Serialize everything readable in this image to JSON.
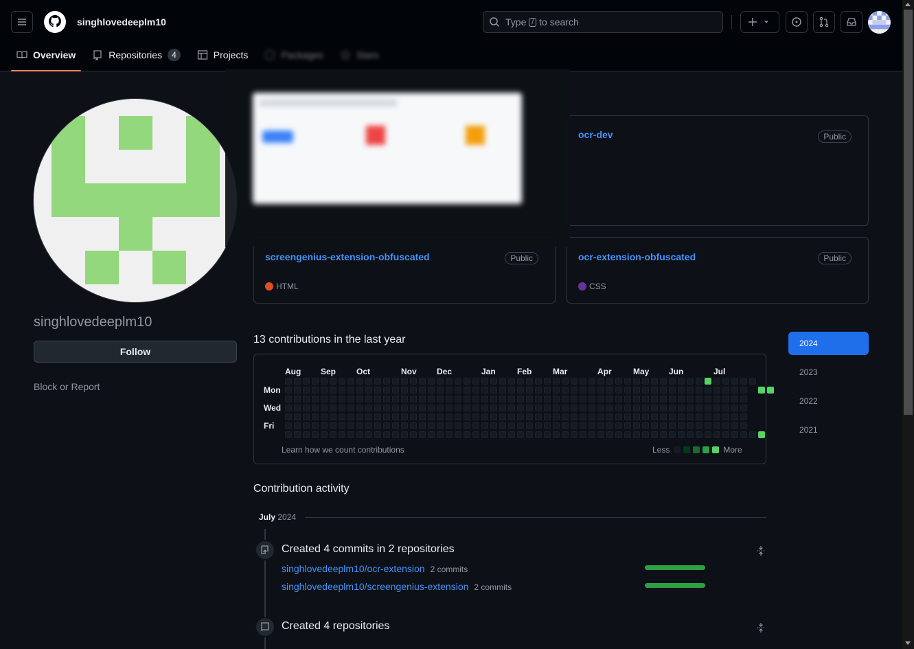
{
  "header": {
    "username": "singhlovedeeplm10",
    "search": {
      "prefix": "Type",
      "key": "/",
      "suffix": "to search"
    }
  },
  "tabs": [
    {
      "label": "Overview",
      "active": true
    },
    {
      "label": "Repositories",
      "count": "4"
    },
    {
      "label": "Projects"
    },
    {
      "label": "Packages"
    },
    {
      "label": "Stars"
    }
  ],
  "profile": {
    "name": "singhlovedeeplm10",
    "follow_label": "Follow",
    "block_label": "Block or Report"
  },
  "pinned": [
    {
      "name": "ocr-dev",
      "visibility": "Public",
      "language": "",
      "lang_color": ""
    },
    {
      "name": "screengenius-extension-obfuscated",
      "visibility": "Public",
      "language": "HTML",
      "lang_color": "#e34c26"
    },
    {
      "name": "ocr-extension-obfuscated",
      "visibility": "Public",
      "language": "CSS",
      "lang_color": "#663399"
    }
  ],
  "contributions": {
    "title": "13 contributions in the last year",
    "months": [
      "Aug",
      "Sep",
      "Oct",
      "Nov",
      "Dec",
      "Jan",
      "Feb",
      "Mar",
      "Apr",
      "May",
      "Jun",
      "Jul"
    ],
    "days": [
      "Mon",
      "Wed",
      "Fri"
    ],
    "learn": "Learn how we count contributions",
    "less": "Less",
    "more": "More",
    "colors": [
      "#151b23",
      "#033a16",
      "#196c2e",
      "#2ea043",
      "#56d364"
    ]
  },
  "years": [
    "2024",
    "2023",
    "2022",
    "2021"
  ],
  "activity": {
    "title": "Contribution activity",
    "month": "July",
    "year": "2024",
    "event1": {
      "title": "Created 4 commits in 2 repositories",
      "repos": [
        {
          "name": "singhlovedeeplm10/ocr-extension",
          "count": "2 commits"
        },
        {
          "name": "singhlovedeeplm10/screengenius-extension",
          "count": "2 commits"
        }
      ]
    },
    "event2": {
      "title": "Created 4 repositories"
    }
  }
}
